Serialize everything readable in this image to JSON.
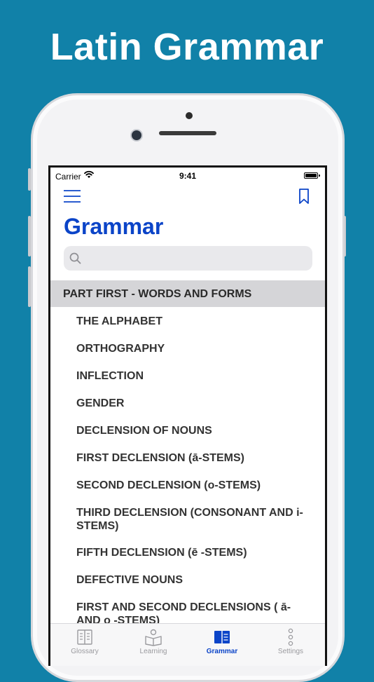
{
  "promo": {
    "title": "Latin Grammar"
  },
  "status_bar": {
    "carrier": "Carrier",
    "time": "9:41"
  },
  "header": {
    "title": "Grammar"
  },
  "search": {
    "placeholder": ""
  },
  "sections": [
    {
      "title": "PART FIRST - WORDS AND FORMS",
      "items": [
        "THE ALPHABET",
        "ORTHOGRAPHY",
        "INFLECTION",
        "GENDER",
        "DECLENSION OF NOUNS",
        "FIRST DECLENSION (ā-STEMS)",
        "SECOND DECLENSION (o-STEMS)",
        "THIRD DECLENSION (CONSONANT AND i-STEMS)",
        "FIFTH DECLENSION (ē -STEMS)",
        "DEFECTIVE NOUNS",
        "FIRST AND SECOND DECLENSIONS ( ā- AND o -STEMS)"
      ]
    }
  ],
  "tabs": [
    {
      "label": "Glossary",
      "icon": "glossary-icon",
      "active": false
    },
    {
      "label": "Learning",
      "icon": "learning-icon",
      "active": false
    },
    {
      "label": "Grammar",
      "icon": "grammar-icon",
      "active": true
    },
    {
      "label": "Settings",
      "icon": "settings-icon",
      "active": false
    }
  ],
  "colors": {
    "background": "#1181a8",
    "accent": "#0b44c8",
    "section_header": "#d5d5d8"
  }
}
